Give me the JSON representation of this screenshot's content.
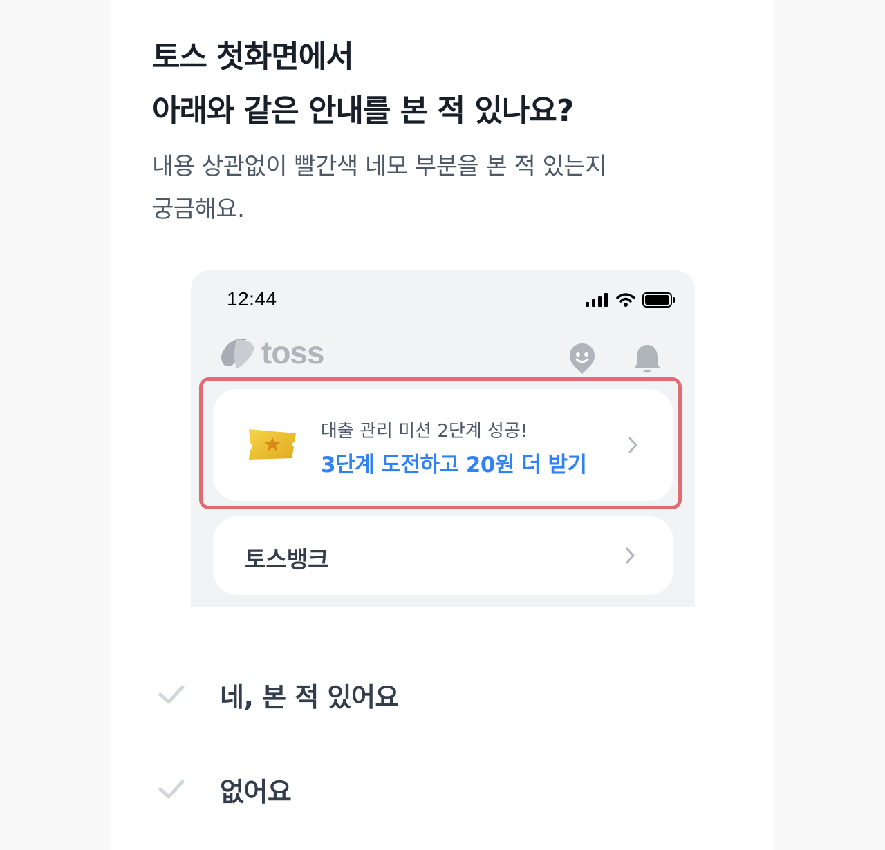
{
  "survey": {
    "title_line1": "토스 첫화면에서",
    "title_line2": "아래와 같은 안내를 본 적 있나요?",
    "subtitle_line1": "내용 상관없이 빨간색 네모 부분을 본 적 있는지",
    "subtitle_line2": "궁금해요."
  },
  "phone": {
    "status_time": "12:44",
    "logo_text": "toss",
    "mission_card": {
      "line1": "대출 관리 미션 2단계 성공!",
      "line2": "3단계 도전하고 20원 더 받기"
    },
    "bank_card": {
      "label": "토스뱅크"
    },
    "colors": {
      "highlight": "#e26a72",
      "accent": "#3182f6",
      "background": "#f2f3f5"
    },
    "icons": [
      "signal-icon",
      "wifi-icon",
      "battery-icon",
      "toss-logo-icon",
      "smiley-icon",
      "bell-icon",
      "ticket-icon",
      "chevron-right-icon"
    ]
  },
  "options": [
    {
      "label": "네, 본 적 있어요",
      "icon": "check-icon"
    },
    {
      "label": "없어요",
      "icon": "check-icon"
    }
  ]
}
